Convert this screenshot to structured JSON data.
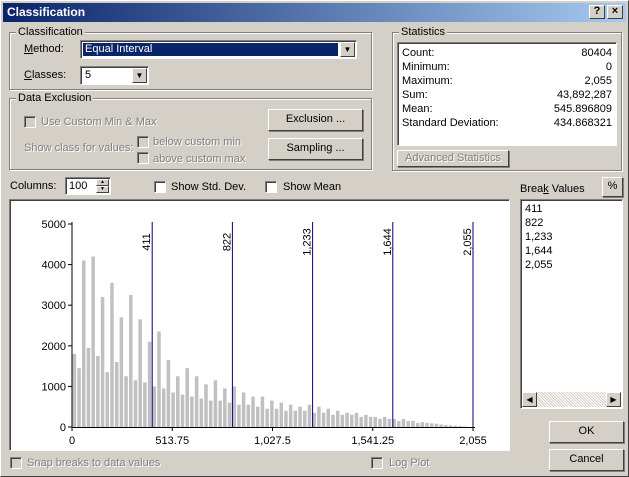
{
  "window": {
    "title": "Classification",
    "help_label": "?",
    "close_label": "×"
  },
  "classification": {
    "legend": "Classification",
    "method_label": "Method:",
    "method_value": "Equal Interval",
    "classes_label": "Classes:",
    "classes_value": "5"
  },
  "statistics": {
    "legend": "Statistics",
    "rows": [
      {
        "k": "Count:",
        "v": "80404"
      },
      {
        "k": "Minimum:",
        "v": "0"
      },
      {
        "k": "Maximum:",
        "v": "2,055"
      },
      {
        "k": "Sum:",
        "v": "43,892,287"
      },
      {
        "k": "Mean:",
        "v": "545.896809"
      },
      {
        "k": "Standard Deviation:",
        "v": "434.868321"
      }
    ],
    "advanced_button": "Advanced Statistics"
  },
  "exclusion": {
    "legend": "Data Exclusion",
    "use_custom_label": "Use Custom Min & Max",
    "show_class_label": "Show class for values:",
    "below_label": "below custom min",
    "above_label": "above custom max",
    "exclusion_button": "Exclusion ...",
    "sampling_button": "Sampling ..."
  },
  "options": {
    "columns_label": "Columns:",
    "columns_value": "100",
    "show_std_label": "Show Std. Dev.",
    "show_mean_label": "Show Mean",
    "snap_label": "Snap breaks to data values",
    "log_label": "Log Plot"
  },
  "break_values": {
    "label": "Break Values",
    "percent_button": "%",
    "items": [
      "411",
      "822",
      "1,233",
      "1,644",
      "2,055"
    ]
  },
  "buttons": {
    "ok": "OK",
    "cancel": "Cancel"
  },
  "chart_data": {
    "type": "bar",
    "xlim": [
      0,
      2055
    ],
    "ylim": [
      0,
      5000
    ],
    "xticks": [
      "0",
      "513.75",
      "1,027.5",
      "1,541.25",
      "2,055"
    ],
    "yticks": [
      "0",
      "1000",
      "2000",
      "3000",
      "4000",
      "5000"
    ],
    "break_lines": [
      411,
      822,
      1233,
      1644,
      2055
    ],
    "break_labels": [
      "411",
      "822",
      "1,233",
      "1,644",
      "2,055"
    ],
    "bar_color": "#c0c0c0",
    "break_color": "#00008b",
    "values": [
      1800,
      1450,
      4100,
      1950,
      4200,
      1750,
      3200,
      1350,
      3550,
      1600,
      2700,
      1250,
      3250,
      1150,
      2650,
      1100,
      2100,
      1000,
      2350,
      950,
      1650,
      850,
      1250,
      800,
      1450,
      750,
      1250,
      700,
      1050,
      650,
      1150,
      650,
      950,
      600,
      1000,
      550,
      850,
      550,
      750,
      500,
      750,
      450,
      650,
      450,
      600,
      400,
      550,
      400,
      500,
      400,
      550,
      350,
      500,
      350,
      450,
      300,
      400,
      300,
      350,
      300,
      350,
      250,
      300,
      250,
      250,
      200,
      250,
      200,
      200,
      150,
      200,
      150,
      150,
      100,
      120,
      100,
      90,
      80,
      60,
      50,
      40,
      30,
      20,
      10
    ]
  }
}
